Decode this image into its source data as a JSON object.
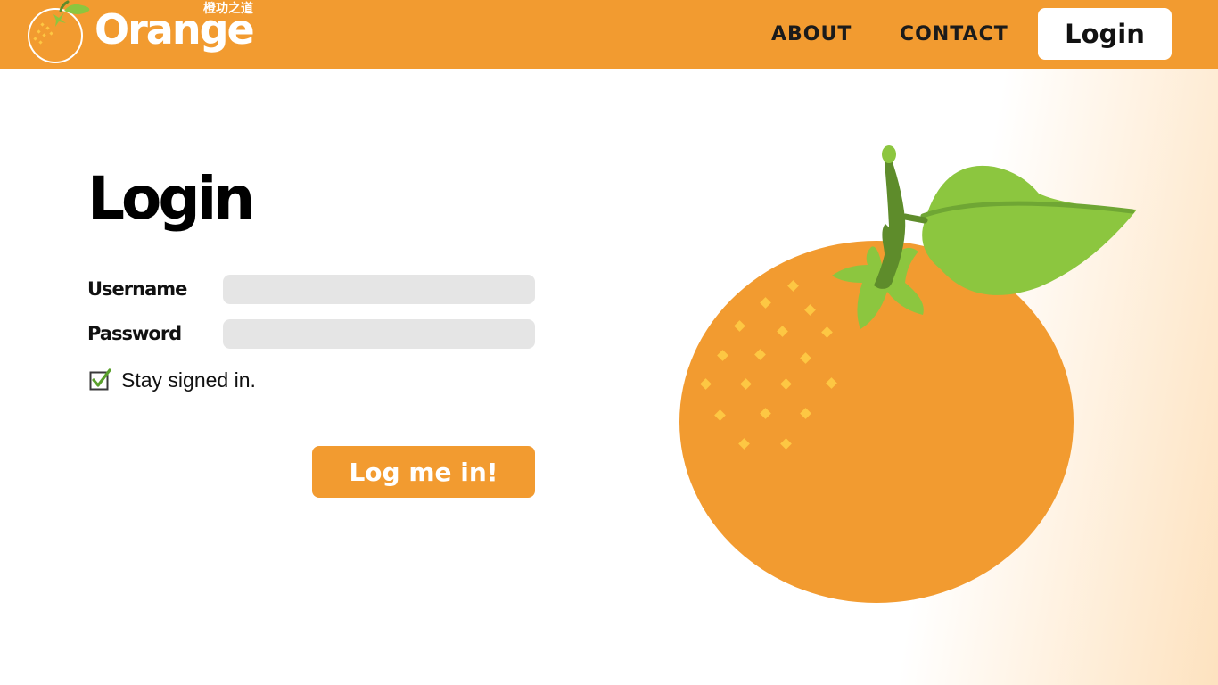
{
  "colors": {
    "brand": "#f29b30",
    "input_bg": "#e5e5e5",
    "leaf": "#8cc63f",
    "stem": "#5e8c2b",
    "dots": "#fdc743"
  },
  "header": {
    "logo": {
      "text": "Orange",
      "subtitle": "橙功之道"
    },
    "nav": {
      "about": "ABOUT",
      "contact": "CONTACT",
      "login": "Login"
    }
  },
  "login_form": {
    "title": "Login",
    "username_label": "Username",
    "username_value": "",
    "password_label": "Password",
    "password_value": "",
    "stay_signed_in_label": "Stay signed in.",
    "stay_signed_in_checked": true,
    "submit_label": "Log me in!"
  },
  "illustration": {
    "icon": "orange-fruit-icon"
  }
}
